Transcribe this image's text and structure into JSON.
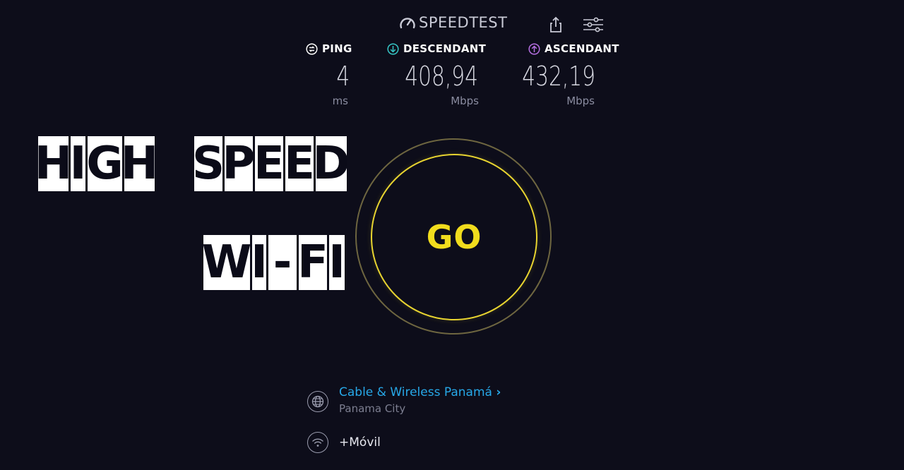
{
  "header": {
    "brand": "SPEEDTEST"
  },
  "metrics": {
    "ping": {
      "label": "PING",
      "value": "4",
      "unit": "ms"
    },
    "download": {
      "label": "DESCENDANT",
      "value": "408,94",
      "unit": "Mbps",
      "color": "#36c5c5"
    },
    "upload": {
      "label": "ASCENDANT",
      "value": "432,19",
      "unit": "Mbps",
      "color": "#b46ee0"
    }
  },
  "overlay": {
    "line1a": [
      "H",
      "I",
      "G",
      "H"
    ],
    "line1b": [
      "S",
      "P",
      "E",
      "E",
      "D"
    ],
    "line2": [
      "W",
      "I",
      "-",
      "F",
      "I"
    ]
  },
  "go": {
    "label": "GO",
    "color": "#f1dc1d"
  },
  "provider": {
    "name": "Cable & Wireless Panamá",
    "chevron": "›",
    "city": "Panama City"
  },
  "connection": {
    "label": "+Móvil"
  },
  "icons": {
    "brand": "speedometer-icon",
    "share": "share-icon",
    "settings": "sliders-icon",
    "ping": "ping-icon",
    "download": "arrow-down-circle-icon",
    "upload": "arrow-up-circle-icon",
    "provider": "globe-icon",
    "connection": "wifi-icon"
  }
}
